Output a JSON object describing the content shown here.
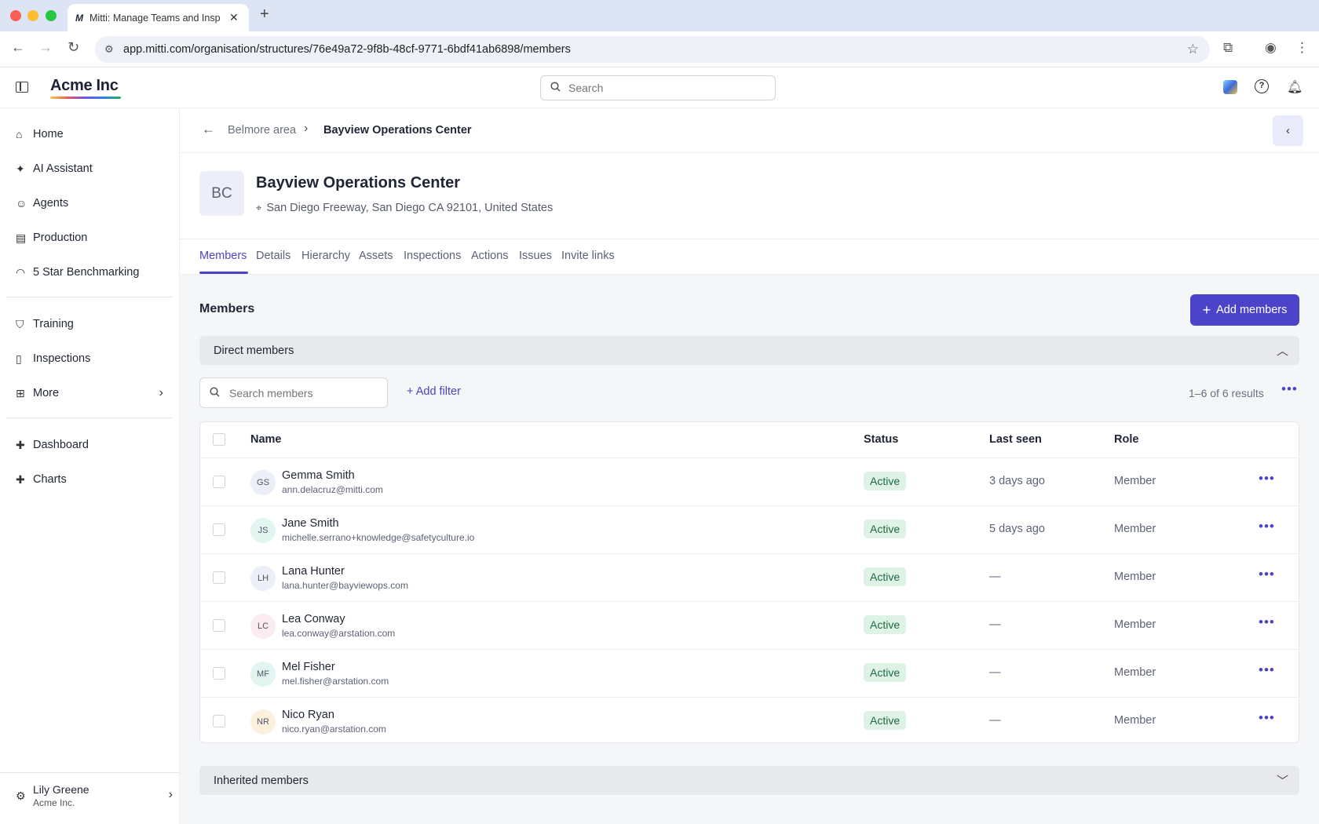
{
  "browser": {
    "tab_title": "Mitti: Manage Teams and Insp",
    "tab_logo": "M",
    "url": "app.mitti.com/organisation/structures/76e49a72-9f8b-48cf-9771-6bdf41ab6898/members"
  },
  "header": {
    "brand": "Acme Inc",
    "search_placeholder": "Search"
  },
  "sidebar": {
    "items": [
      {
        "label": "Home",
        "icon": "home-icon"
      },
      {
        "label": "AI Assistant",
        "icon": "sparkle-icon"
      },
      {
        "label": "Agents",
        "icon": "robot-icon"
      },
      {
        "label": "Production",
        "icon": "building-icon"
      },
      {
        "label": "5 Star Benchmarking",
        "icon": "gauge-icon"
      },
      {
        "label": "Training",
        "icon": "graduation-cap-icon"
      },
      {
        "label": "Inspections",
        "icon": "clipboard-icon"
      },
      {
        "label": "More",
        "icon": "grid-icon"
      },
      {
        "label": "Dashboard",
        "icon": "puzzle-icon"
      },
      {
        "label": "Charts",
        "icon": "puzzle-icon"
      }
    ],
    "user": {
      "name": "Lily Greene",
      "org": "Acme Inc."
    }
  },
  "breadcrumb": {
    "parent": "Belmore area",
    "current": "Bayview Operations Center"
  },
  "site": {
    "initials": "BC",
    "title": "Bayview Operations Center",
    "address": "San Diego Freeway, San Diego CA 92101, United States"
  },
  "tabs": [
    "Members",
    "Details",
    "Hierarchy",
    "Assets",
    "Inspections",
    "Actions",
    "Issues",
    "Invite links"
  ],
  "members_section": {
    "title": "Members",
    "add_button": "Add members",
    "direct_label": "Direct members",
    "inherited_label": "Inherited members",
    "search_placeholder": "Search members",
    "add_filter": "Add filter",
    "results": "1–6 of 6 results"
  },
  "table": {
    "columns": [
      "Name",
      "Status",
      "Last seen",
      "Role"
    ],
    "rows": [
      {
        "initials": "GS",
        "name": "Gemma Smith",
        "email": "ann.delacruz@mitti.com",
        "status": "Active",
        "last_seen": "3 days ago",
        "role": "Member",
        "avatar_color": "#eceef8"
      },
      {
        "initials": "JS",
        "name": "Jane Smith",
        "email": "michelle.serrano+knowledge@safetyculture.io",
        "status": "Active",
        "last_seen": "5 days ago",
        "role": "Member",
        "avatar_color": "#e3f5f1"
      },
      {
        "initials": "LH",
        "name": "Lana Hunter",
        "email": "lana.hunter@bayviewops.com",
        "status": "Active",
        "last_seen": "—",
        "role": "Member",
        "avatar_color": "#eceef8"
      },
      {
        "initials": "LC",
        "name": "Lea Conway",
        "email": "lea.conway@arstation.com",
        "status": "Active",
        "last_seen": "—",
        "role": "Member",
        "avatar_color": "#fcebef"
      },
      {
        "initials": "MF",
        "name": "Mel Fisher",
        "email": "mel.fisher@arstation.com",
        "status": "Active",
        "last_seen": "—",
        "role": "Member",
        "avatar_color": "#e3f5f1"
      },
      {
        "initials": "NR",
        "name": "Nico Ryan",
        "email": "nico.ryan@arstation.com",
        "status": "Active",
        "last_seen": "—",
        "role": "Member",
        "avatar_color": "#fdf1dd"
      }
    ]
  }
}
